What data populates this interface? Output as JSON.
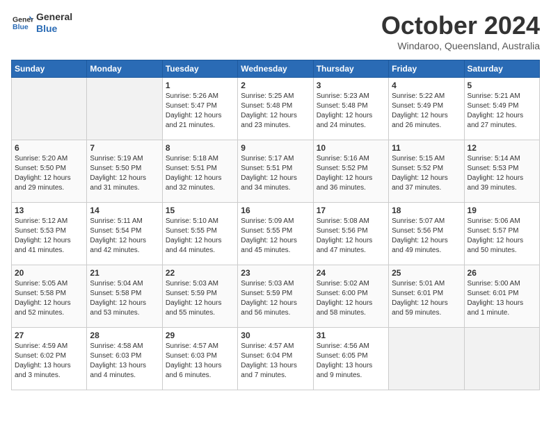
{
  "header": {
    "logo_line1": "General",
    "logo_line2": "Blue",
    "month": "October 2024",
    "location": "Windaroo, Queensland, Australia"
  },
  "weekdays": [
    "Sunday",
    "Monday",
    "Tuesday",
    "Wednesday",
    "Thursday",
    "Friday",
    "Saturday"
  ],
  "weeks": [
    [
      {
        "day": "",
        "text": ""
      },
      {
        "day": "",
        "text": ""
      },
      {
        "day": "1",
        "text": "Sunrise: 5:26 AM\nSunset: 5:47 PM\nDaylight: 12 hours and 21 minutes."
      },
      {
        "day": "2",
        "text": "Sunrise: 5:25 AM\nSunset: 5:48 PM\nDaylight: 12 hours and 23 minutes."
      },
      {
        "day": "3",
        "text": "Sunrise: 5:23 AM\nSunset: 5:48 PM\nDaylight: 12 hours and 24 minutes."
      },
      {
        "day": "4",
        "text": "Sunrise: 5:22 AM\nSunset: 5:49 PM\nDaylight: 12 hours and 26 minutes."
      },
      {
        "day": "5",
        "text": "Sunrise: 5:21 AM\nSunset: 5:49 PM\nDaylight: 12 hours and 27 minutes."
      }
    ],
    [
      {
        "day": "6",
        "text": "Sunrise: 5:20 AM\nSunset: 5:50 PM\nDaylight: 12 hours and 29 minutes."
      },
      {
        "day": "7",
        "text": "Sunrise: 5:19 AM\nSunset: 5:50 PM\nDaylight: 12 hours and 31 minutes."
      },
      {
        "day": "8",
        "text": "Sunrise: 5:18 AM\nSunset: 5:51 PM\nDaylight: 12 hours and 32 minutes."
      },
      {
        "day": "9",
        "text": "Sunrise: 5:17 AM\nSunset: 5:51 PM\nDaylight: 12 hours and 34 minutes."
      },
      {
        "day": "10",
        "text": "Sunrise: 5:16 AM\nSunset: 5:52 PM\nDaylight: 12 hours and 36 minutes."
      },
      {
        "day": "11",
        "text": "Sunrise: 5:15 AM\nSunset: 5:52 PM\nDaylight: 12 hours and 37 minutes."
      },
      {
        "day": "12",
        "text": "Sunrise: 5:14 AM\nSunset: 5:53 PM\nDaylight: 12 hours and 39 minutes."
      }
    ],
    [
      {
        "day": "13",
        "text": "Sunrise: 5:12 AM\nSunset: 5:53 PM\nDaylight: 12 hours and 41 minutes."
      },
      {
        "day": "14",
        "text": "Sunrise: 5:11 AM\nSunset: 5:54 PM\nDaylight: 12 hours and 42 minutes."
      },
      {
        "day": "15",
        "text": "Sunrise: 5:10 AM\nSunset: 5:55 PM\nDaylight: 12 hours and 44 minutes."
      },
      {
        "day": "16",
        "text": "Sunrise: 5:09 AM\nSunset: 5:55 PM\nDaylight: 12 hours and 45 minutes."
      },
      {
        "day": "17",
        "text": "Sunrise: 5:08 AM\nSunset: 5:56 PM\nDaylight: 12 hours and 47 minutes."
      },
      {
        "day": "18",
        "text": "Sunrise: 5:07 AM\nSunset: 5:56 PM\nDaylight: 12 hours and 49 minutes."
      },
      {
        "day": "19",
        "text": "Sunrise: 5:06 AM\nSunset: 5:57 PM\nDaylight: 12 hours and 50 minutes."
      }
    ],
    [
      {
        "day": "20",
        "text": "Sunrise: 5:05 AM\nSunset: 5:58 PM\nDaylight: 12 hours and 52 minutes."
      },
      {
        "day": "21",
        "text": "Sunrise: 5:04 AM\nSunset: 5:58 PM\nDaylight: 12 hours and 53 minutes."
      },
      {
        "day": "22",
        "text": "Sunrise: 5:03 AM\nSunset: 5:59 PM\nDaylight: 12 hours and 55 minutes."
      },
      {
        "day": "23",
        "text": "Sunrise: 5:03 AM\nSunset: 5:59 PM\nDaylight: 12 hours and 56 minutes."
      },
      {
        "day": "24",
        "text": "Sunrise: 5:02 AM\nSunset: 6:00 PM\nDaylight: 12 hours and 58 minutes."
      },
      {
        "day": "25",
        "text": "Sunrise: 5:01 AM\nSunset: 6:01 PM\nDaylight: 12 hours and 59 minutes."
      },
      {
        "day": "26",
        "text": "Sunrise: 5:00 AM\nSunset: 6:01 PM\nDaylight: 13 hours and 1 minute."
      }
    ],
    [
      {
        "day": "27",
        "text": "Sunrise: 4:59 AM\nSunset: 6:02 PM\nDaylight: 13 hours and 3 minutes."
      },
      {
        "day": "28",
        "text": "Sunrise: 4:58 AM\nSunset: 6:03 PM\nDaylight: 13 hours and 4 minutes."
      },
      {
        "day": "29",
        "text": "Sunrise: 4:57 AM\nSunset: 6:03 PM\nDaylight: 13 hours and 6 minutes."
      },
      {
        "day": "30",
        "text": "Sunrise: 4:57 AM\nSunset: 6:04 PM\nDaylight: 13 hours and 7 minutes."
      },
      {
        "day": "31",
        "text": "Sunrise: 4:56 AM\nSunset: 6:05 PM\nDaylight: 13 hours and 9 minutes."
      },
      {
        "day": "",
        "text": ""
      },
      {
        "day": "",
        "text": ""
      }
    ]
  ]
}
